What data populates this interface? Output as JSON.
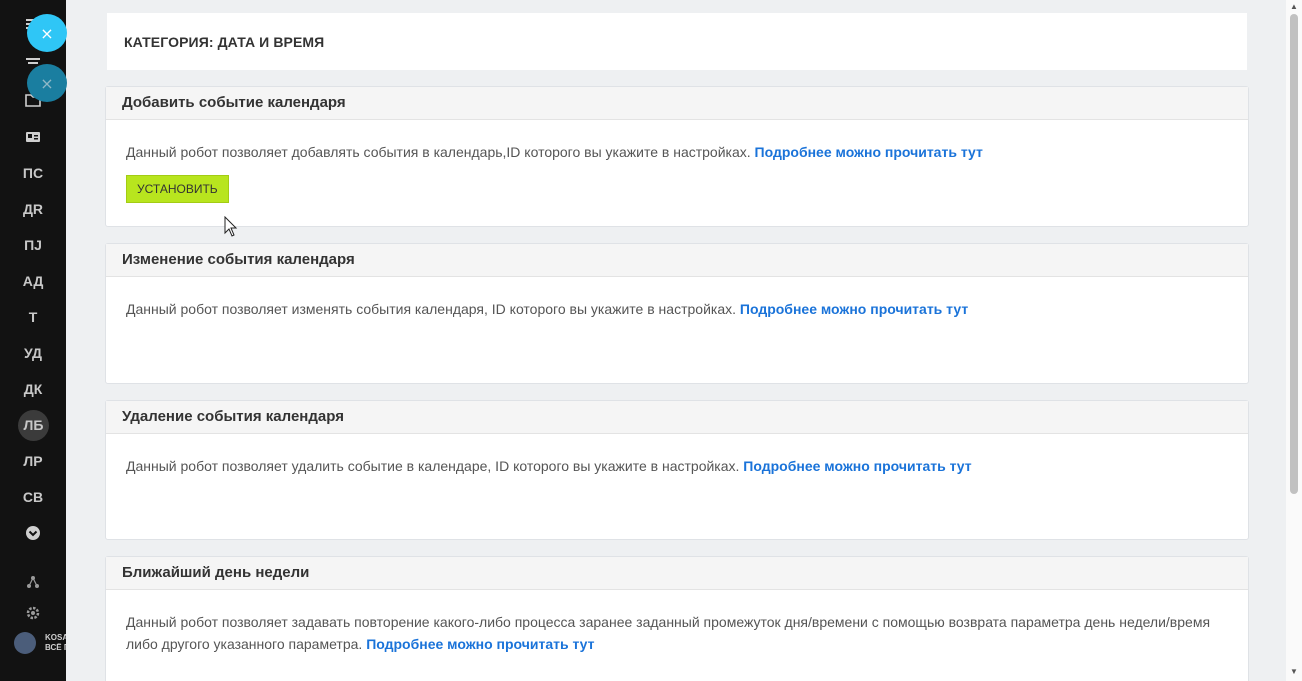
{
  "sidebar": {
    "close_icon": "×",
    "items": [
      {
        "label": "ПС"
      },
      {
        "label": "ДR"
      },
      {
        "label": "ПJ"
      },
      {
        "label": "АД"
      },
      {
        "label": "Т"
      },
      {
        "label": "УД"
      },
      {
        "label": "ДК"
      },
      {
        "label": "ЛБ"
      },
      {
        "label": "ЛР"
      },
      {
        "label": "СВ"
      }
    ],
    "user": {
      "line1": "KOSA",
      "line2": "ВСЁ П"
    }
  },
  "header": {
    "title": "КАТЕГОРИЯ: ДАТА И ВРЕМЯ"
  },
  "cards": [
    {
      "title": "Добавить событие календаря",
      "text": "Данный робот позволяет добавлять события в календарь,ID которого вы укажите в настройках.",
      "link": "Подробнее можно прочитать тут",
      "button": "УСТАНОВИТЬ"
    },
    {
      "title": "Изменение события календаря",
      "text": "Данный робот позволяет изменять события календаря, ID которого вы укажите в настройках.",
      "link": "Подробнее можно прочитать тут"
    },
    {
      "title": "Удаление события календаря",
      "text": "Данный робот позволяет удалить событие в календаре, ID которого вы укажите в настройках.",
      "link": "Подробнее можно прочитать тут"
    },
    {
      "title": "Ближайший день недели",
      "text": "Данный робот позволяет задавать повторение какого-либо процесса заранее заданный промежуток дня/времени с помощью возврата параметра день недели/время либо другого указанного параметра.",
      "link": "Подробнее можно прочитать тут"
    }
  ],
  "colors": {
    "accent_link": "#1a73d9",
    "install_button": "#b8e51e",
    "close_button": "#2fc6f6",
    "sidebar_bg": "#121212"
  }
}
